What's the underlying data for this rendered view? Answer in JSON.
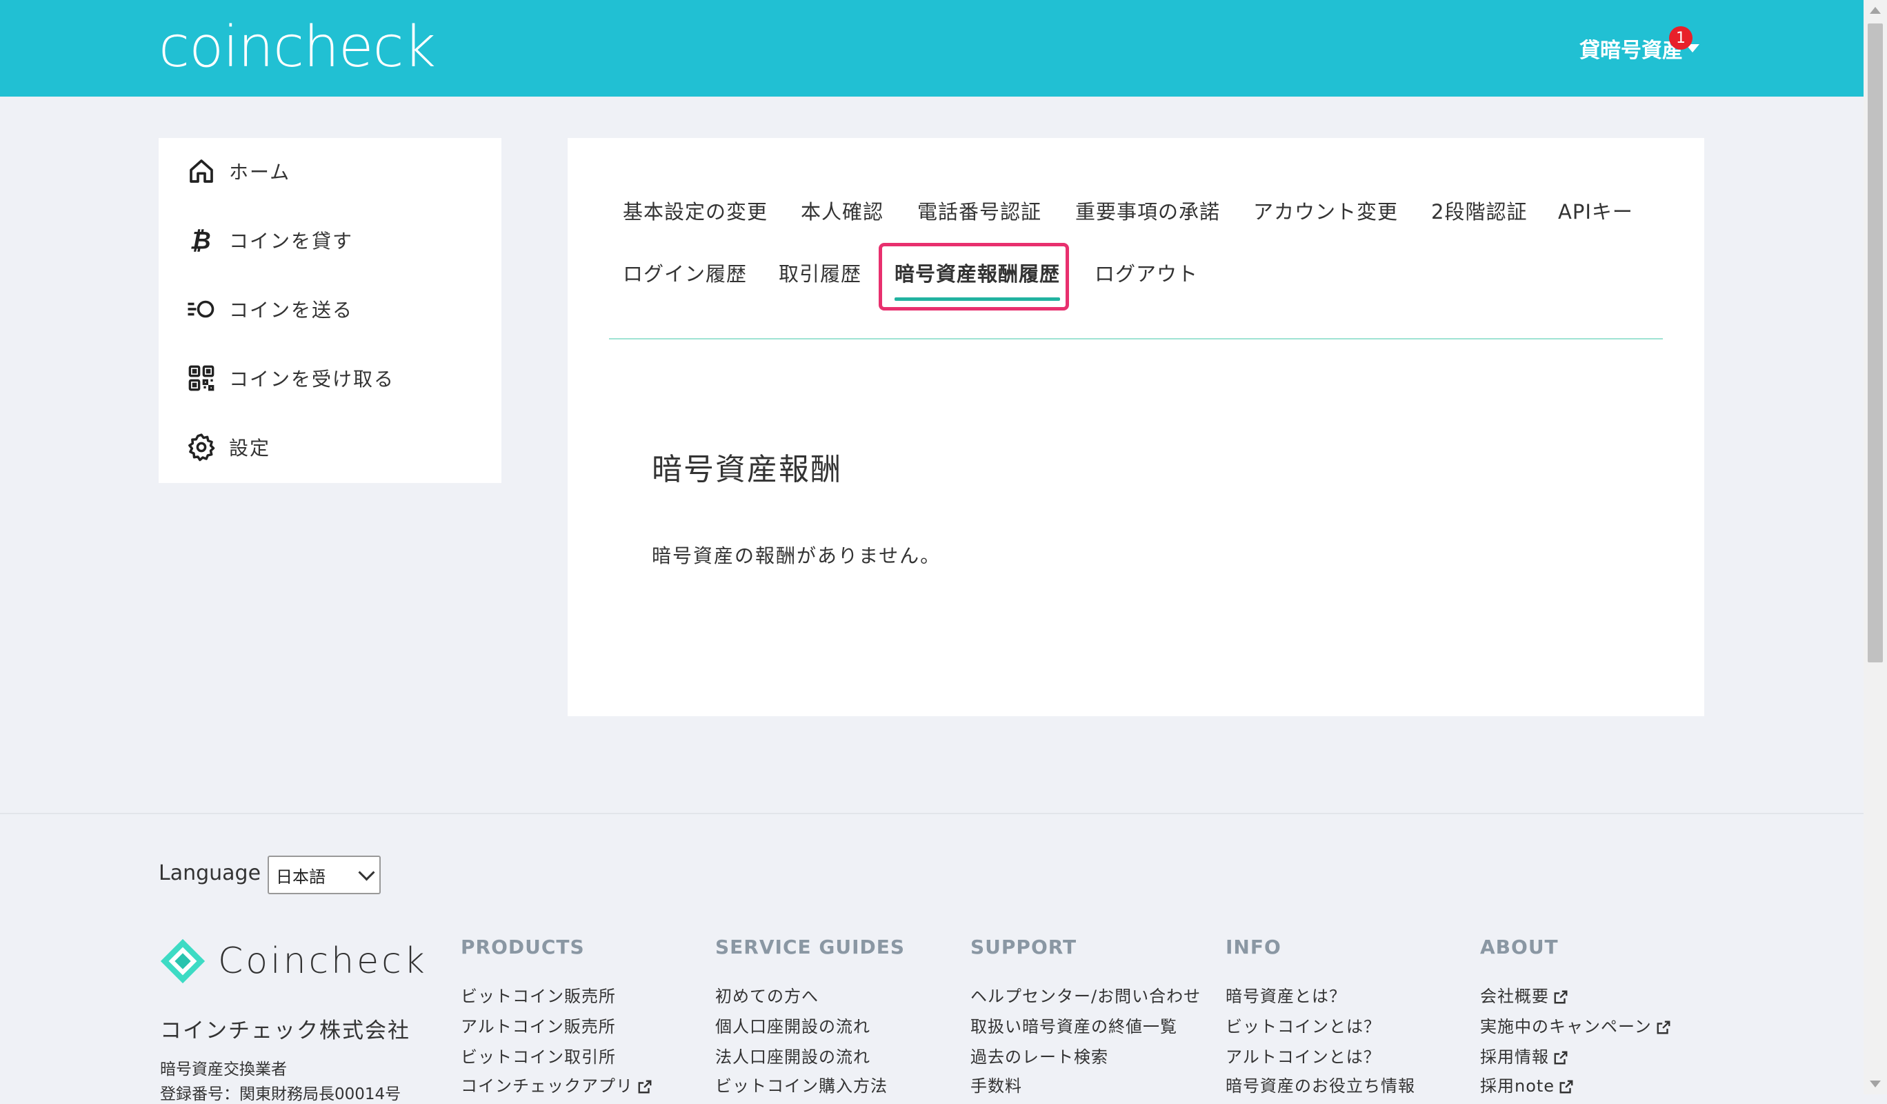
{
  "header": {
    "logo": "coincheck",
    "account_menu_label": "貸暗号資産",
    "notification_count": "1"
  },
  "sidebar": {
    "items": [
      {
        "label": "ホーム",
        "icon": "home-icon"
      },
      {
        "label": "コインを貸す",
        "icon": "bitcoin-icon"
      },
      {
        "label": "コインを送る",
        "icon": "send-icon"
      },
      {
        "label": "コインを受け取る",
        "icon": "qr-code-icon"
      },
      {
        "label": "設定",
        "icon": "gear-icon"
      }
    ]
  },
  "settings_tabs": {
    "row1": [
      "基本設定の変更",
      "本人確認",
      "電話番号認証",
      "重要事項の承諾",
      "アカウント変更",
      "2段階認証",
      "APIキー"
    ],
    "row2": [
      "ログイン履歴",
      "取引履歴",
      "暗号資産報酬履歴",
      "ログアウト"
    ],
    "active": "暗号資産報酬履歴"
  },
  "content": {
    "title": "暗号資産報酬",
    "empty_message": "暗号資産の報酬がありません。"
  },
  "footer": {
    "language_label": "Language",
    "language_value": "日本語",
    "brand": "Coincheck",
    "company": "コインチェック株式会社",
    "reg_line1": "暗号資産交換業者",
    "reg_line2": "登録番号：関東財務局長00014号",
    "columns": [
      {
        "title": "PRODUCTS",
        "links": [
          "ビットコイン販売所",
          "アルトコイン販売所",
          "ビットコイン取引所",
          "コインチェックアプリ"
        ]
      },
      {
        "title": "SERVICE GUIDES",
        "links": [
          "初めての方へ",
          "個人口座開設の流れ",
          "法人口座開設の流れ",
          "ビットコイン購入方法"
        ]
      },
      {
        "title": "SUPPORT",
        "links": [
          "ヘルプセンター/お問い合わせ",
          "取扱い暗号資産の終値一覧",
          "過去のレート検索",
          "手数料"
        ]
      },
      {
        "title": "INFO",
        "links": [
          "暗号資産とは？",
          "ビットコインとは？",
          "アルトコインとは？",
          "暗号資産のお役立ち情報"
        ]
      },
      {
        "title": "ABOUT",
        "links": [
          "会社概要",
          "実施中のキャンペーン",
          "採用情報",
          "採用note"
        ]
      }
    ]
  },
  "colors": {
    "header_bg": "#21c0d3",
    "active_tab_border": "#e8306e",
    "active_tab_underline": "#21b3a0",
    "badge": "#e8202a"
  }
}
